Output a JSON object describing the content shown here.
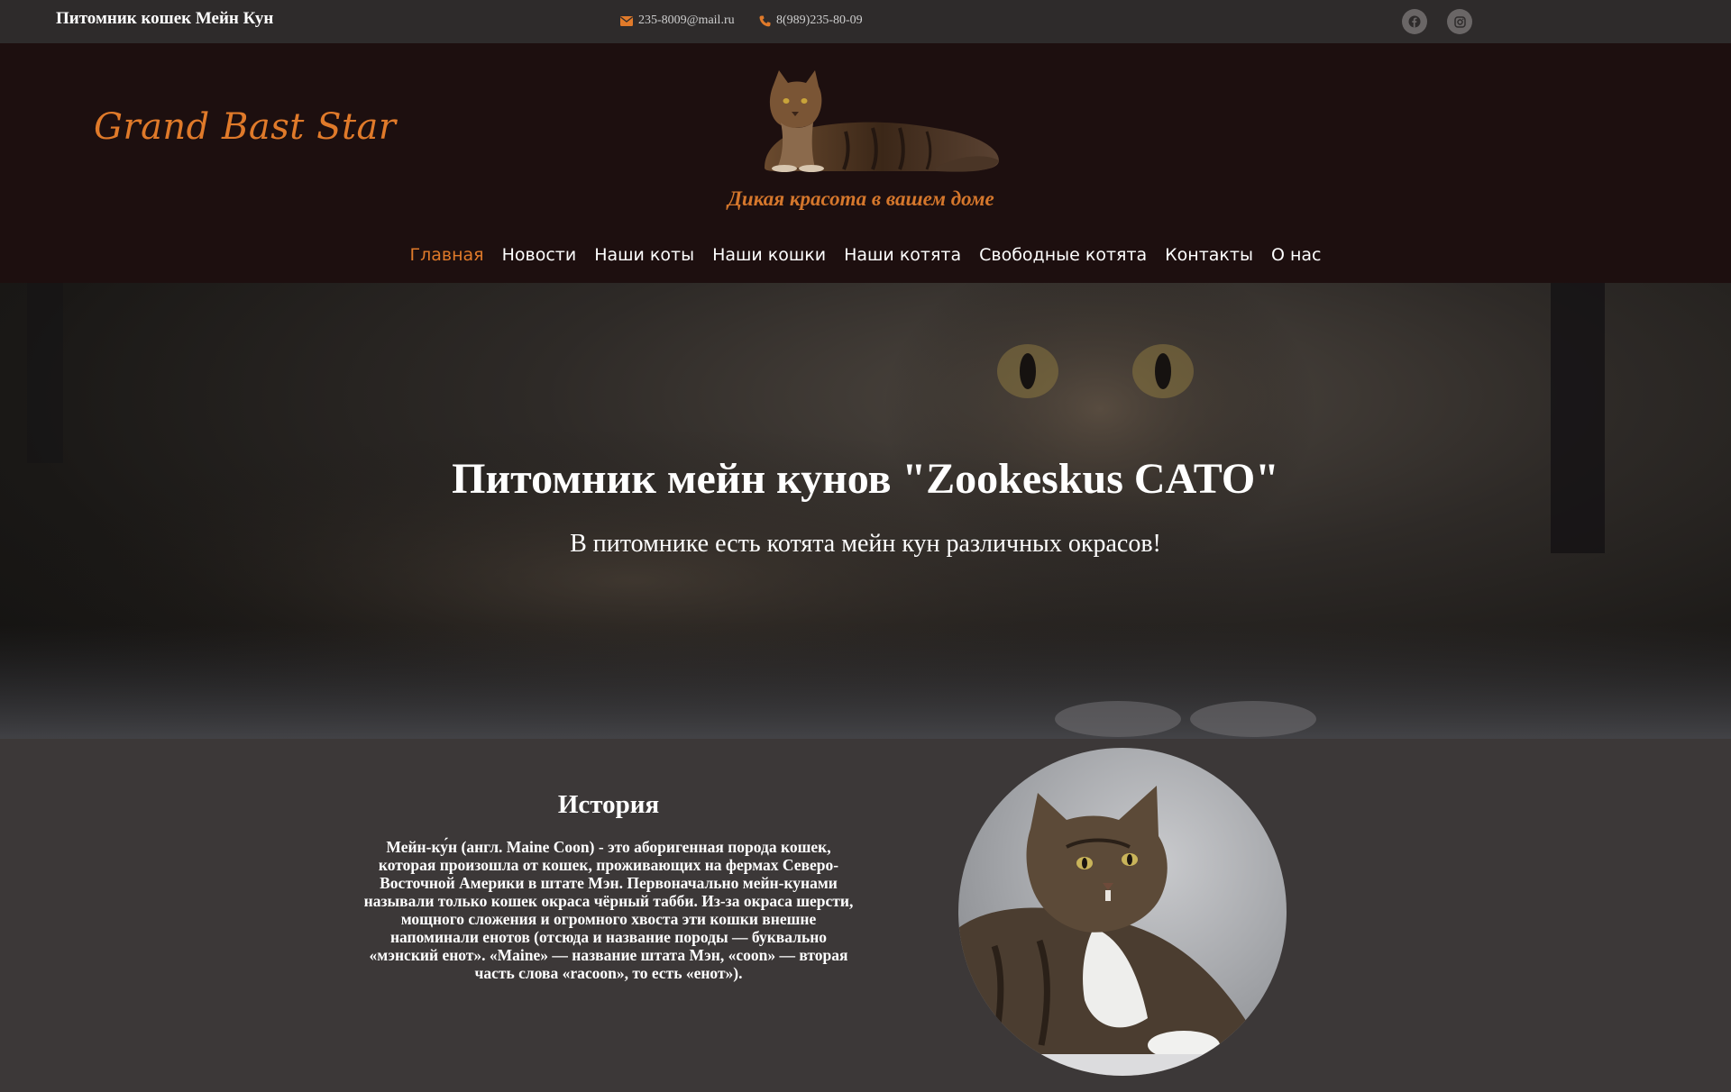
{
  "topbar": {
    "site_name": "Питомник кошек Мейн Кун",
    "email": "235-8009@mail.ru",
    "phone": "8(989)235-80-09",
    "social": [
      "facebook-icon",
      "instagram-icon"
    ]
  },
  "header": {
    "brand": "Grand Bast Star",
    "tagline": "Дикая красота в вашем доме",
    "accent_color": "#e07a2a"
  },
  "nav": {
    "items": [
      {
        "label": "Главная",
        "active": true
      },
      {
        "label": "Новости"
      },
      {
        "label": "Наши коты"
      },
      {
        "label": "Наши кошки"
      },
      {
        "label": "Наши котята"
      },
      {
        "label": "Свободные котята"
      },
      {
        "label": "Контакты"
      },
      {
        "label": "О нас"
      }
    ]
  },
  "hero": {
    "title": "Питомник мейн кунов \"Zookeskus CATO\"",
    "subtitle": "В питомнике есть котята мейн кун различных окрасов!"
  },
  "history": {
    "title": "История",
    "text": "Мейн-ку́н (англ. Maine Coon) - это аборигенная порода кошек, которая произошла от кошек, проживающих на фермах Северо-Восточной Америки в штате Мэн. Первоначально мейн-кунами называли только кошек окраса чёрный табби. Из-за окраса шерсти, мощного сложения и огромного хвоста эти кошки внешне напоминали енотов (отсюда и название породы — буквально «мэнский енот». «Maine» — название штата Мэн, «coon» — вторая часть слова «racoon», то есть «енот»)."
  }
}
